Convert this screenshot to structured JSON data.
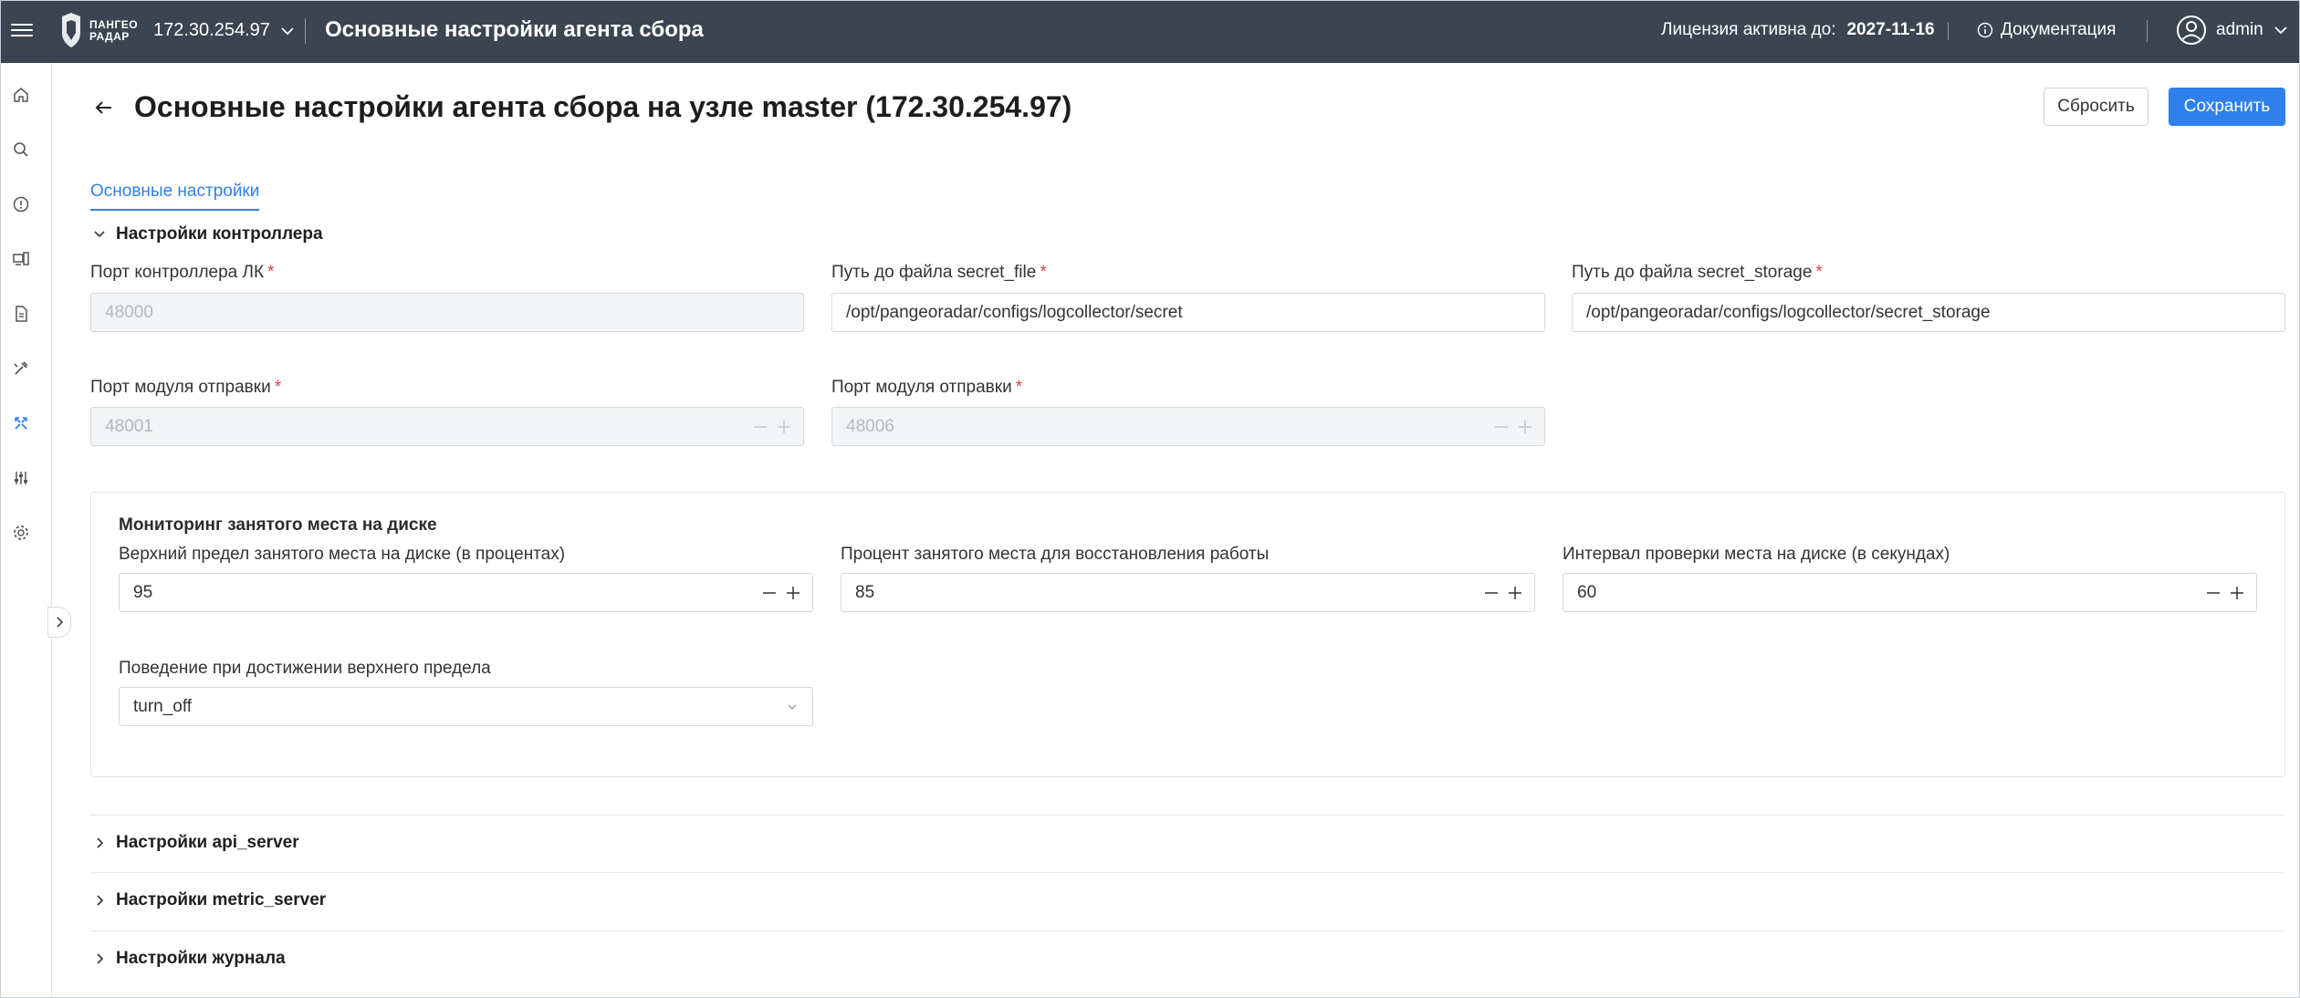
{
  "topbar": {
    "logo_line1": "ПАНГЕО",
    "logo_line2": "РАДАР",
    "host": "172.30.254.97",
    "title": "Основные настройки агента сбора",
    "license_label": "Лицензия активна до:",
    "license_date": "2027-11-16",
    "docs_label": "Документация",
    "user": "admin"
  },
  "sidebar": {
    "icons": [
      "home-icon",
      "search-icon",
      "info-icon",
      "devices-icon",
      "document-icon",
      "tools-icon",
      "collector-icon",
      "sliders-icon",
      "gear-icon"
    ],
    "active_icon": "collector-icon",
    "accent": "#2f80ed"
  },
  "header": {
    "title": "Основные настройки агента сбора на узле master (172.30.254.97)",
    "reset_label": "Сбросить",
    "save_label": "Сохранить"
  },
  "tabs": [
    {
      "label": "Основные настройки",
      "active": true
    }
  ],
  "controller": {
    "section_title": "Настройки контроллера",
    "port_lk": {
      "label": "Порт контроллера ЛК",
      "value": "48000",
      "disabled": true
    },
    "secret_file": {
      "label": "Путь до файла secret_file",
      "value": "/opt/pangeoradar/configs/logcollector/secret"
    },
    "secret_storage": {
      "label": "Путь до файла secret_storage",
      "value": "/opt/pangeoradar/configs/logcollector/secret_storage"
    },
    "send_port_1": {
      "label": "Порт модуля отправки",
      "value": "48001",
      "disabled": true
    },
    "send_port_2": {
      "label": "Порт модуля отправки",
      "value": "48006",
      "disabled": true
    }
  },
  "disk": {
    "title": "Мониторинг занятого места на диске",
    "upper_limit": {
      "label": "Верхний предел занятого места на диске (в процентах)",
      "value": "95"
    },
    "recovery": {
      "label": "Процент занятого места для восстановления работы",
      "value": "85"
    },
    "interval": {
      "label": "Интервал проверки места на диске (в секундах)",
      "value": "60"
    },
    "behavior": {
      "label": "Поведение при достижении верхнего предела",
      "value": "turn_off"
    }
  },
  "collapsed_sections": [
    "Настройки api_server",
    "Настройки metric_server",
    "Настройки журнала"
  ]
}
